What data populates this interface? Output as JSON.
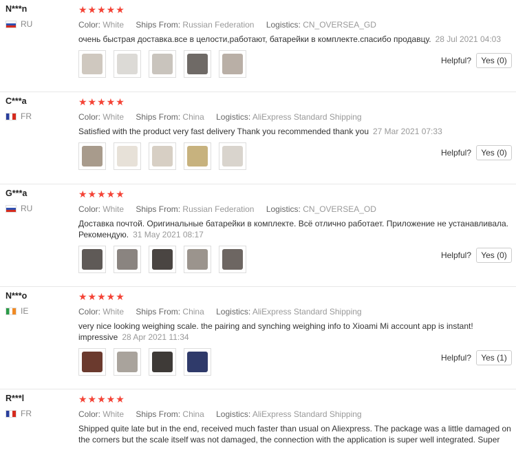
{
  "labels": {
    "color": "Color:",
    "ships_from": "Ships From:",
    "logistics": "Logistics:",
    "helpful": "Helpful?",
    "stars": "★★★★★"
  },
  "reviews": [
    {
      "user": "N***n",
      "country": "RU",
      "color": "White",
      "ships_from": "Russian Federation",
      "logistics": "CN_OVERSEA_GD",
      "text": "очень быстрая доставка.все в целости,работают, батарейки в комплекте.спасибо продавцу.",
      "date": "28 Jul 2021 04:03",
      "helpful_label": "Yes (0)",
      "rating": 5
    },
    {
      "user": "C***a",
      "country": "FR",
      "color": "White",
      "ships_from": "China",
      "logistics": "AliExpress Standard Shipping",
      "text": "Satisfied with the product very fast delivery Thank you recommended thank you",
      "date": "27 Mar 2021 07:33",
      "helpful_label": "Yes (0)",
      "rating": 5
    },
    {
      "user": "G***a",
      "country": "RU",
      "color": "White",
      "ships_from": "Russian Federation",
      "logistics": "CN_OVERSEA_OD",
      "text": "Доставка почтой. Оригинальные батарейки в комплекте. Всё отлично работает. Приложение не устанавливала. Рекомендую.",
      "date": "31 May 2021 08:17",
      "helpful_label": "Yes (0)",
      "rating": 5
    },
    {
      "user": "N***o",
      "country": "IE",
      "color": "White",
      "ships_from": "China",
      "logistics": "AliExpress Standard Shipping",
      "text": "very nice looking weighing scale. the pairing and synching weighing info to Xioami Mi account app is instant! impressive",
      "date": "28 Apr 2021 11:34",
      "helpful_label": "Yes (1)",
      "rating": 5
    },
    {
      "user": "R***l",
      "country": "FR",
      "color": "White",
      "ships_from": "China",
      "logistics": "AliExpress Standard Shipping",
      "text": "Shipped quite late but in the end, received much faster than usual on Aliexpress. The package was a little damaged on the corners but the scale itself was not damaged, the connection with the application is super well integrated. Super",
      "rating": 5
    }
  ],
  "colors": {
    "star": "#f44336",
    "muted": "#999999",
    "thumb_tones": [
      "#cfc8bf",
      "#dcdad6",
      "#c9c4bd",
      "#6f6a66",
      "#b9afa6",
      "#e7e1d8",
      "#a89b8c"
    ]
  }
}
